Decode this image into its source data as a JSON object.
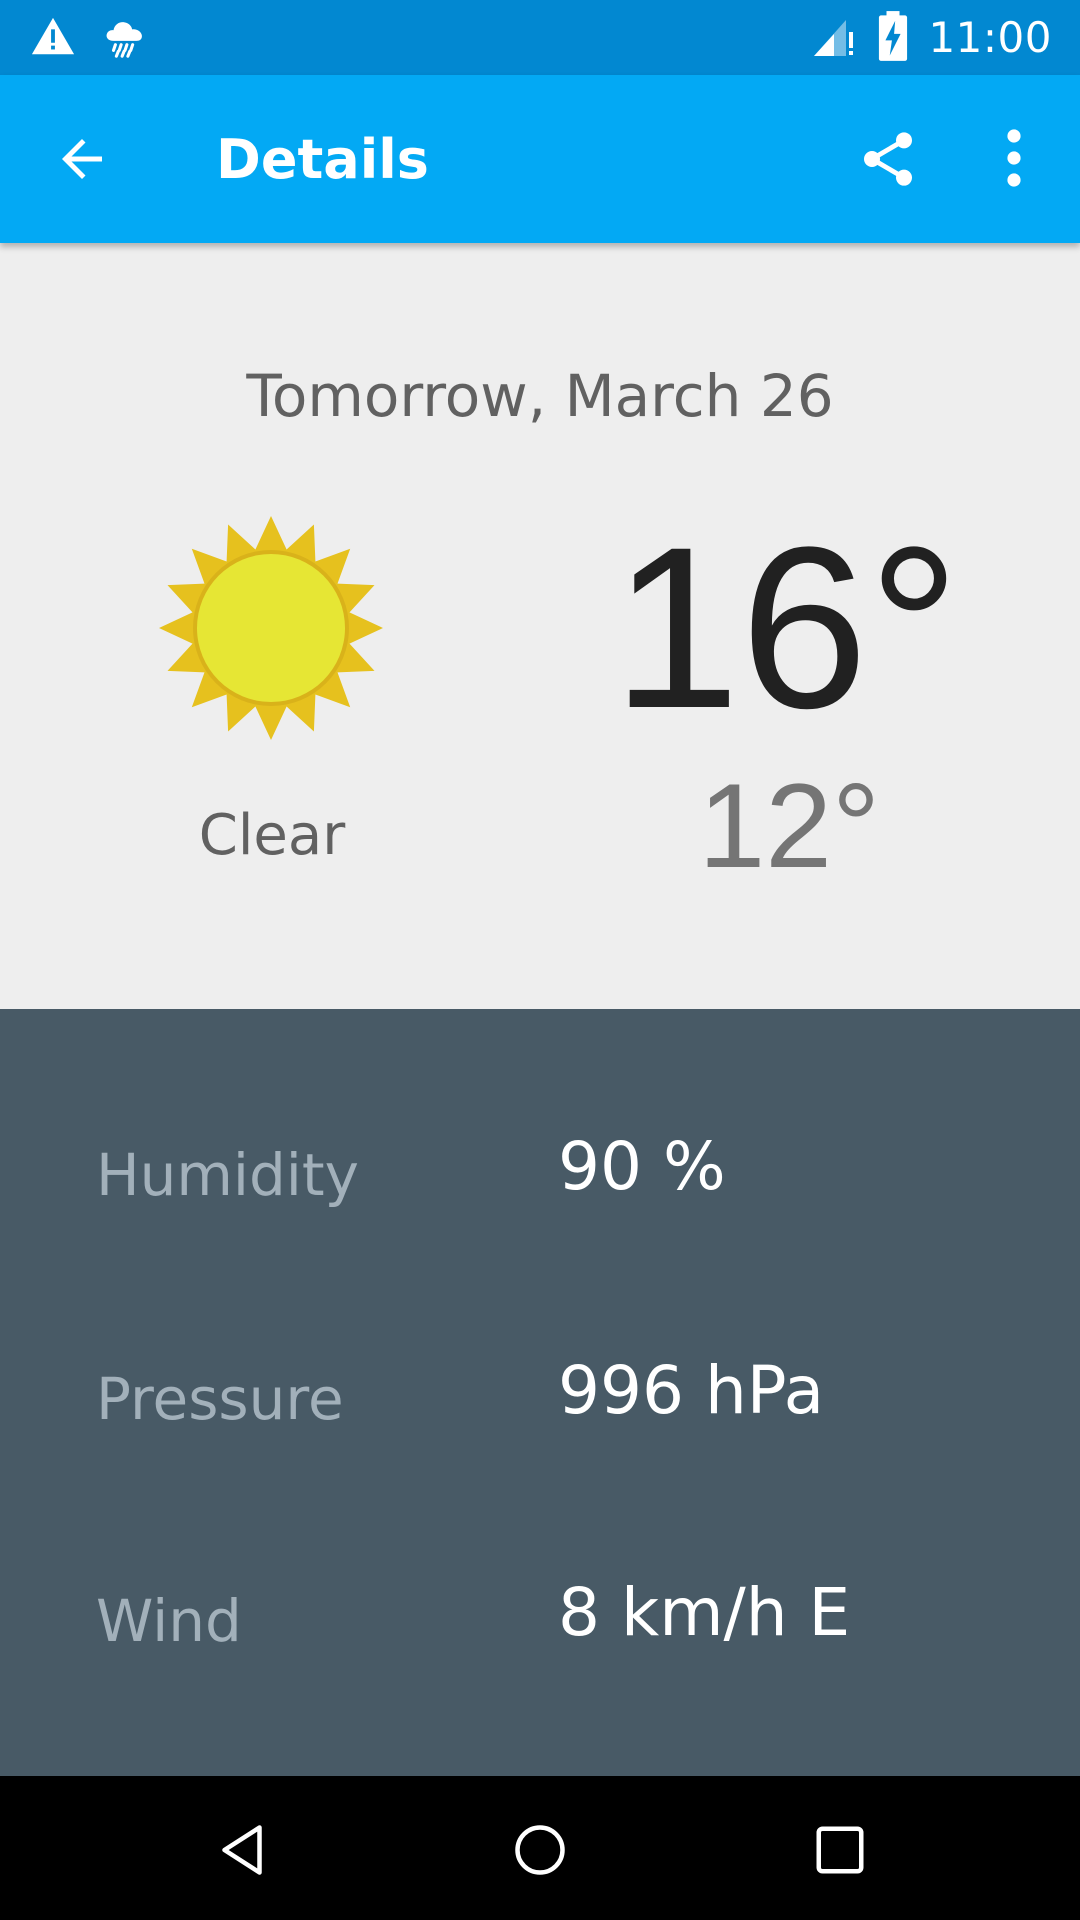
{
  "status_bar": {
    "time": "11:00",
    "icons": [
      "warning-icon",
      "rain-cloud-icon",
      "signal-icon",
      "battery-charging-icon"
    ]
  },
  "app_bar": {
    "title": "Details",
    "back_icon": "arrow-back-icon",
    "share_icon": "share-icon",
    "more_icon": "more-vert-icon"
  },
  "forecast": {
    "date": "Tomorrow, March 26",
    "condition": "Clear",
    "icon": "sun-icon",
    "high": "16°",
    "low": "12°"
  },
  "details": [
    {
      "label": "Humidity",
      "value": "90 %"
    },
    {
      "label": "Pressure",
      "value": "996 hPa"
    },
    {
      "label": "Wind",
      "value": "8 km/h E"
    }
  ],
  "nav_bar": {
    "icons": [
      "nav-back-icon",
      "nav-home-icon",
      "nav-recents-icon"
    ]
  },
  "colors": {
    "status_bar": "#0288D1",
    "app_bar": "#03A9F4",
    "main_bg": "#EEEEEE",
    "details_bg": "#485A66",
    "sun_outer": "#E6C11E",
    "sun_inner": "#E6E634"
  }
}
